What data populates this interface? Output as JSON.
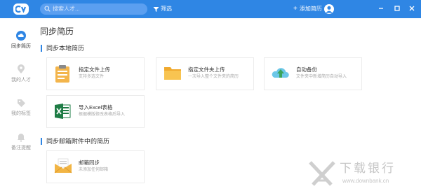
{
  "topbar": {
    "search_placeholder": "搜索人才...",
    "filter_label": "筛选",
    "add_label": "添加简历",
    "accent": "#2f86e4"
  },
  "sidebar": {
    "items": [
      {
        "label": "同步简历",
        "icon": "cloud-icon",
        "active": true
      },
      {
        "label": "我的人才",
        "icon": "pin-icon",
        "active": false
      },
      {
        "label": "我的标签",
        "icon": "tag-icon",
        "active": false
      },
      {
        "label": "备注提醒",
        "icon": "bell-icon",
        "active": false
      }
    ]
  },
  "main": {
    "title": "同步简历",
    "section_local": "同步本地简历",
    "section_email": "同步邮箱附件中的简历",
    "cards": [
      {
        "title": "指定文件上传",
        "sub": "支持多选文件",
        "icon": "document-icon"
      },
      {
        "title": "指定文件夹上传",
        "sub": "一次导入整个文件夹的简历",
        "icon": "folder-icon"
      },
      {
        "title": "自动备份",
        "sub": "文件夹中新增简历自动导入",
        "icon": "cloud-backup-icon"
      },
      {
        "title": "导入Excel表格",
        "sub": "根据模版修改表格后导入",
        "icon": "excel-icon"
      },
      {
        "title": "邮箱同步",
        "sub": "未添加任何邮箱",
        "icon": "envelope-icon"
      }
    ]
  },
  "watermark": {
    "title": "下载银行",
    "url": "www.downbank.cn"
  }
}
